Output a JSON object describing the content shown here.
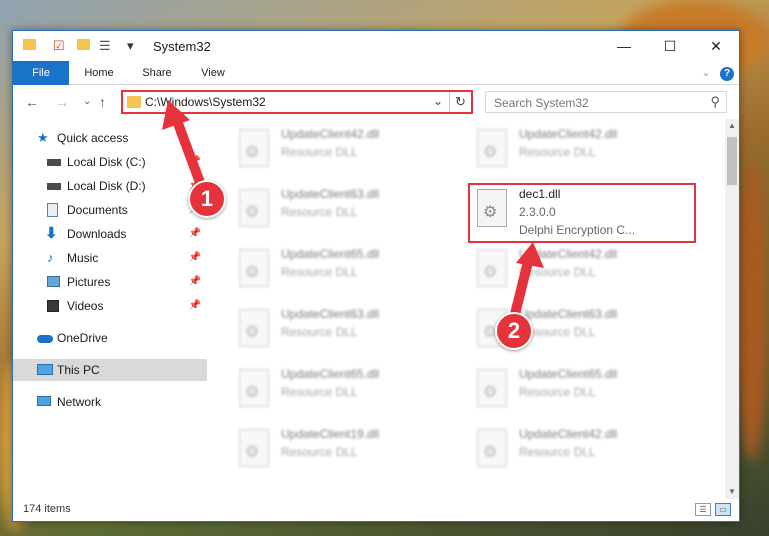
{
  "window": {
    "title": "System32",
    "quick_access_dropdown": "▾"
  },
  "ribbon": {
    "tabs": [
      "File",
      "Home",
      "Share",
      "View"
    ]
  },
  "address_bar": {
    "path": "C:\\Windows\\System32"
  },
  "search": {
    "placeholder": "Search System32"
  },
  "nav": {
    "items": [
      {
        "label": "Quick access",
        "icon": "star-icon",
        "pinned": false
      },
      {
        "label": "Local Disk (C:)",
        "icon": "drive-icon",
        "pinned": true
      },
      {
        "label": "Local Disk (D:)",
        "icon": "drive-icon",
        "pinned": true
      },
      {
        "label": "Documents",
        "icon": "documents-icon",
        "pinned": true
      },
      {
        "label": "Downloads",
        "icon": "download-icon",
        "pinned": true
      },
      {
        "label": "Music",
        "icon": "music-icon",
        "pinned": true
      },
      {
        "label": "Pictures",
        "icon": "pictures-icon",
        "pinned": true
      },
      {
        "label": "Videos",
        "icon": "videos-icon",
        "pinned": true
      },
      {
        "label": "OneDrive",
        "icon": "cloud-icon",
        "pinned": false
      },
      {
        "label": "This PC",
        "icon": "pc-icon",
        "pinned": false,
        "selected": true
      },
      {
        "label": "Network",
        "icon": "network-icon",
        "pinned": false
      }
    ]
  },
  "files": {
    "left_column": [
      {
        "name": "UpdateClient42.dll",
        "type": "Resource DLL"
      },
      {
        "name": "UpdateClient63.dll",
        "type": "Resource DLL"
      },
      {
        "name": "UpdateClient65.dll",
        "type": "Resource DLL"
      },
      {
        "name": "UpdateClient63.dll",
        "type": "Resource DLL"
      },
      {
        "name": "UpdateClient65.dll",
        "type": "Resource DLL"
      },
      {
        "name": "UpdateClient19.dll",
        "type": "Resource DLL"
      }
    ],
    "right_column": [
      {
        "name": "UpdateClient42.dll",
        "type": "Resource DLL"
      },
      {
        "name": "UpdateClient42.dll",
        "type": "Resource DLL"
      },
      {
        "name": "UpdateClient63.dll",
        "type": "Resource DLL"
      },
      {
        "name": "UpdateClient65.dll",
        "type": "Resource DLL"
      },
      {
        "name": "UpdateClient42.dll",
        "type": "Resource DLL"
      }
    ],
    "highlighted": {
      "name": "dec1.dll",
      "version": "2.3.0.0",
      "description": "Delphi Encryption C..."
    }
  },
  "status": {
    "item_count": "174 items"
  },
  "callouts": [
    "1",
    "2"
  ],
  "colors": {
    "accent": "#1a73c8",
    "highlight": "#e5323b"
  }
}
